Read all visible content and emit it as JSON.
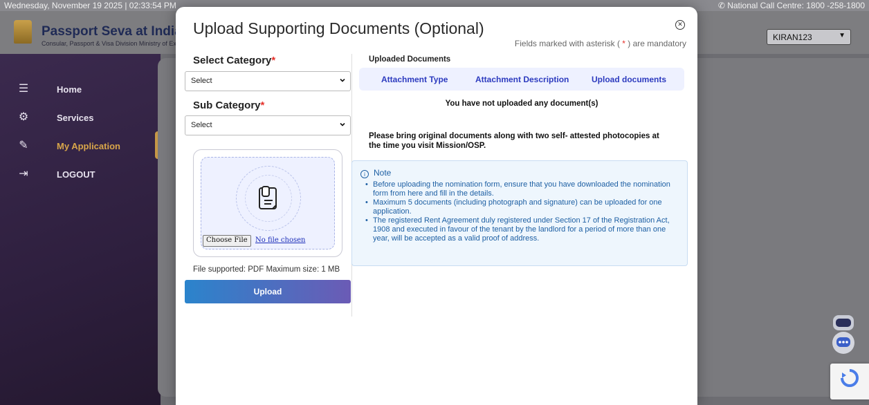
{
  "topbar": {
    "datetime": "Wednesday, November 19 2025 | 02:33:54 PM",
    "call_centre": "✆ National Call Centre: 1800 -258-1800"
  },
  "header": {
    "title": "Passport Seva at India",
    "subtitle": "Consular, Passport & Visa Division Ministry of External Affairs",
    "user": "KIRAN123"
  },
  "sidebar": {
    "items": [
      {
        "label": "Home",
        "icon": "home-search-icon"
      },
      {
        "label": "Services",
        "icon": "services-icon"
      },
      {
        "label": "My Application",
        "icon": "application-icon"
      },
      {
        "label": "LOGOUT",
        "icon": "logout-icon"
      }
    ]
  },
  "modal": {
    "title": "Upload Supporting Documents (Optional)",
    "mandatory_prefix": "Fields marked with asterisk (",
    "mandatory_ast": " * ",
    "mandatory_suffix": ") are mandatory",
    "category_label": "Select Category",
    "category_value": "Select",
    "subcategory_label": "Sub Category",
    "subcategory_value": "Select",
    "choose_file": "Choose File",
    "no_file": "No file chosen",
    "file_supported": "File supported: PDF   Maximum size: 1 MB",
    "upload_button": "Upload",
    "uploaded_title": "Uploaded Documents",
    "columns": [
      "Attachment Type",
      "Attachment Description",
      "Upload documents"
    ],
    "empty_message": "You have not uploaded any document(s)",
    "bring_message": "Please bring original documents along with two self- attested photocopies at the time you visit Mission/OSP.",
    "note_title": "Note",
    "notes": [
      "Before uploading the nomination form, ensure that you have downloaded the nomination form from here and fill in the details.",
      "Maximum 5 documents (including photograph and signature) can be uploaded for one application.",
      "The registered Rent Agreement duly registered under Section 17 of the Registration Act, 1908 and executed in favour of the tenant by the landlord for a period of more than one year, will be accepted as a valid proof of address."
    ]
  },
  "colors": {
    "accent_blue": "#2d3bbf",
    "note_blue": "#1d5fa3",
    "asterisk_red": "#e5302a",
    "sidebar_gold": "#c69746"
  }
}
